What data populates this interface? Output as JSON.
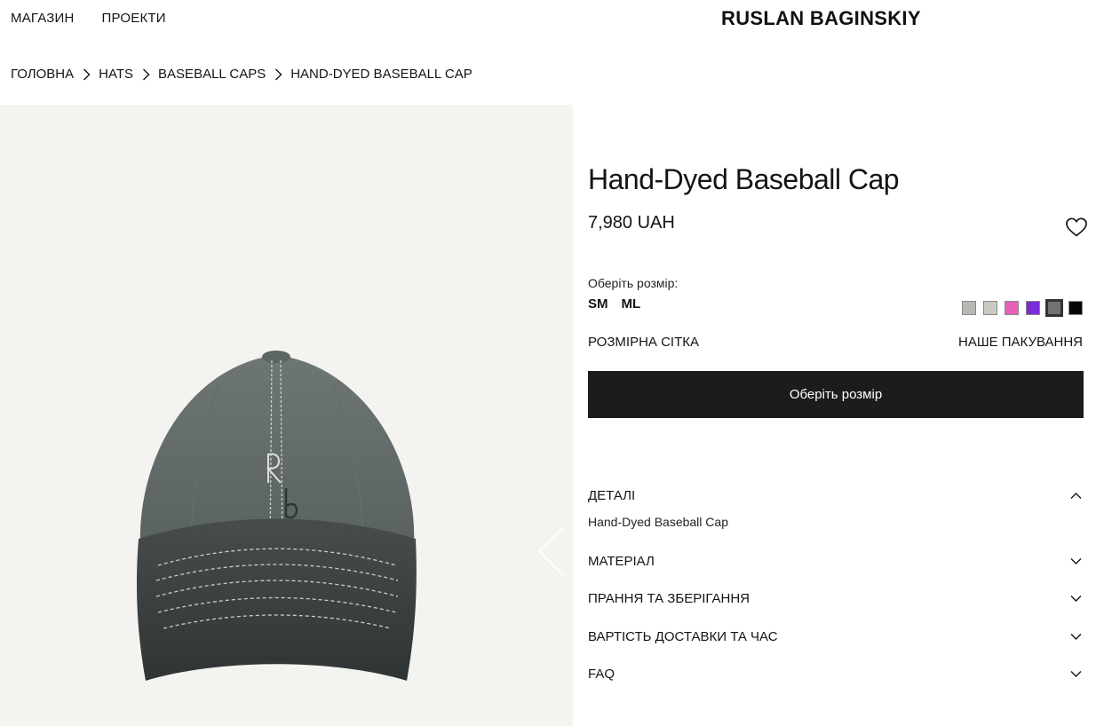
{
  "nav": {
    "shop": "МАГАЗИН",
    "projects": "ПРОЕКТИ"
  },
  "brand": {
    "logo": "RUSLAN BAGINSKIY"
  },
  "breadcrumb": [
    "ГОЛОВНА",
    "HATS",
    "BASEBALL CAPS",
    "HAND-DYED BASEBALL CAP"
  ],
  "product": {
    "title": "Hand-Dyed Baseball Cap",
    "price": "7,980 UAH",
    "size_label": "Оберіть розмір:",
    "sizes": [
      "SM",
      "ML"
    ],
    "colors": [
      {
        "name": "light-grey",
        "hex": "#b8b8b4"
      },
      {
        "name": "pale-grey",
        "hex": "#c9c9c4"
      },
      {
        "name": "pink",
        "hex": "#e860b8"
      },
      {
        "name": "purple",
        "hex": "#7a2cd6"
      },
      {
        "name": "graphite",
        "hex": "#6f7473",
        "selected": true
      },
      {
        "name": "black",
        "hex": "#050505"
      }
    ],
    "size_chart_link": "РОЗМІРНА СІТКА",
    "packaging_link": "НАШЕ ПАКУВАННЯ",
    "cta_label": "Оберіть розмір"
  },
  "accordion": {
    "details": {
      "label": "ДЕТАЛІ",
      "content": "Hand-Dyed Baseball Cap",
      "expanded": true
    },
    "material": {
      "label": "МАТЕРІАЛ"
    },
    "care": {
      "label": "ПРАННЯ ТА ЗБЕРІГАННЯ"
    },
    "shipping": {
      "label": "ВАРТІСТЬ ДОСТАВКИ ТА ЧАС"
    },
    "faq": {
      "label": "FAQ"
    }
  },
  "icons": [
    "chevron-right-icon",
    "chevron-left-icon",
    "heart-icon",
    "chevron-up-icon",
    "chevron-down-icon"
  ]
}
